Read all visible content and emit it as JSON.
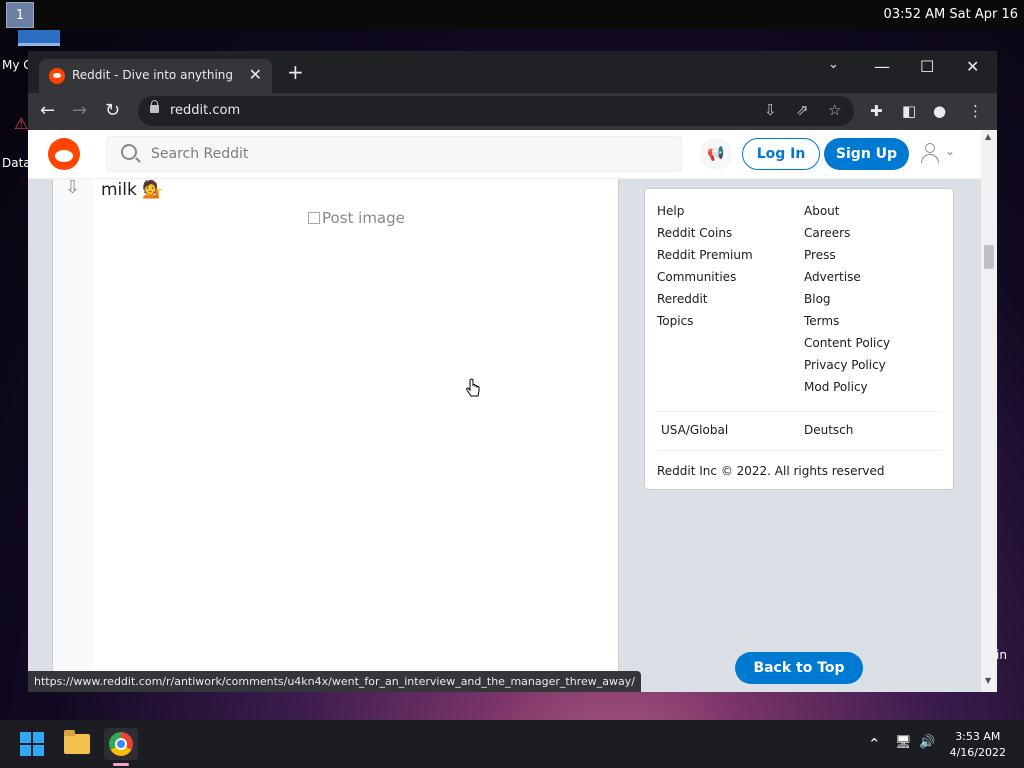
{
  "system": {
    "workspace": "1",
    "clock_top": "03:52 AM  Sat Apr 16"
  },
  "desktop": {
    "icon1_label": "My C",
    "icon2_label": "Data",
    "right_label": "in"
  },
  "browser": {
    "tab_title": "Reddit - Dive into anything",
    "url": "reddit.com",
    "status_url": "https://www.reddit.com/r/antiwork/comments/u4kn4x/went_for_an_interview_and_the_manager_threw_away/"
  },
  "reddit": {
    "search_placeholder": "Search Reddit",
    "login": "Log In",
    "signup": "Sign Up",
    "post_title": "milk 💁",
    "post_image_alt": "Post image",
    "links_left": [
      "Help",
      "Reddit Coins",
      "Reddit Premium",
      "Communities",
      "Rereddit",
      "Topics"
    ],
    "links_right": [
      "About",
      "Careers",
      "Press",
      "Advertise",
      "Blog",
      "Terms",
      "Content Policy",
      "Privacy Policy",
      "Mod Policy"
    ],
    "lang_left": "USA/Global",
    "lang_right": "Deutsch",
    "copyright": "Reddit Inc © 2022. All rights reserved",
    "back_to_top": "Back to Top"
  },
  "taskbar": {
    "time": "3:53 AM",
    "date": "4/16/2022"
  }
}
